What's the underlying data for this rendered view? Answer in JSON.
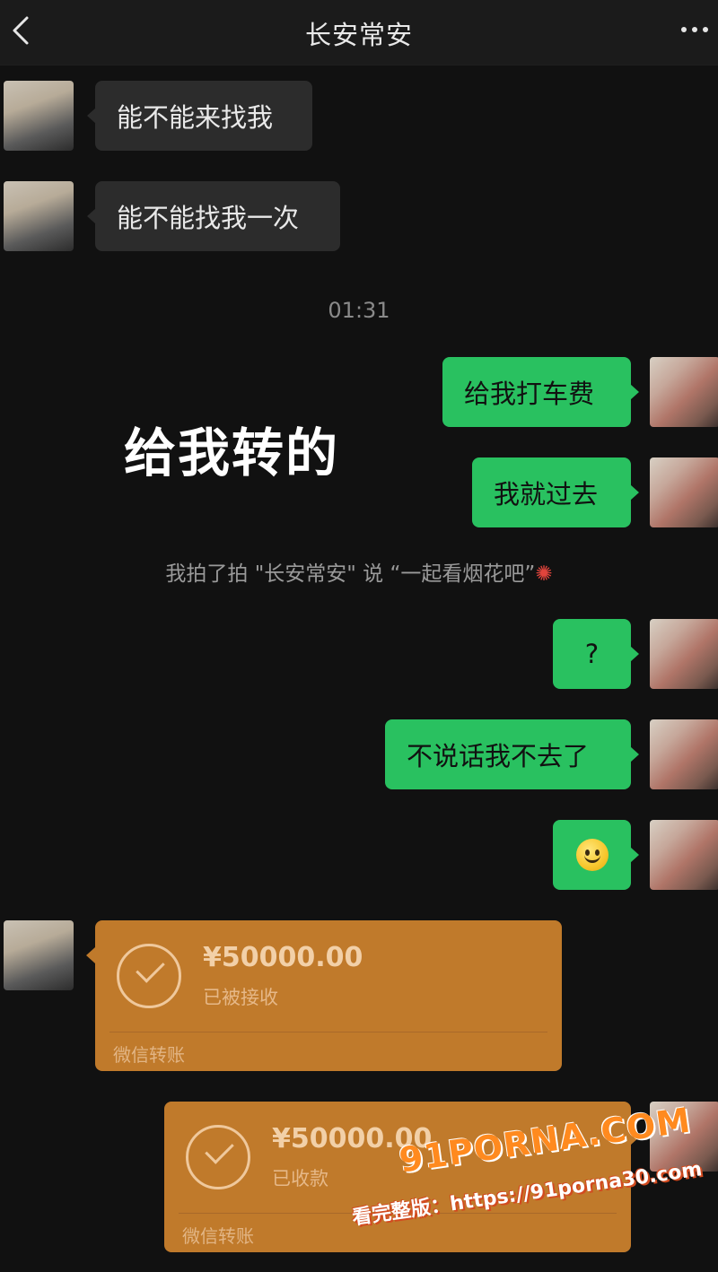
{
  "header": {
    "title": "长安常安",
    "back_icon": "chevron-left-icon",
    "more_icon": "more-horizontal-icon"
  },
  "messages": {
    "m1": "能不能来找我",
    "m2": "能不能找我一次",
    "timestamp": "01:31",
    "m3": "给我打车费",
    "m4": "我就过去",
    "system": "我拍了拍 \"长安常安\" 说 “一起看烟花吧”",
    "system_icon": "firework-icon",
    "m5": "?",
    "m6": "不说话我不去了",
    "m7_icon": "smile-emoji-icon"
  },
  "overlay_caption": "给我转的",
  "transfers": {
    "t1": {
      "amount": "¥50000.00",
      "status": "已被接收",
      "label": "微信转账"
    },
    "t2": {
      "amount": "¥50000.00",
      "status": "已收款",
      "label": "微信转账"
    }
  },
  "watermark": {
    "logo": "91PORNA.COM",
    "url": "看完整版：https://91porna30.com"
  },
  "colors": {
    "background": "#111111",
    "self_bubble": "#29c160",
    "other_bubble": "#2c2c2c",
    "transfer_card": "#c07a2b"
  }
}
